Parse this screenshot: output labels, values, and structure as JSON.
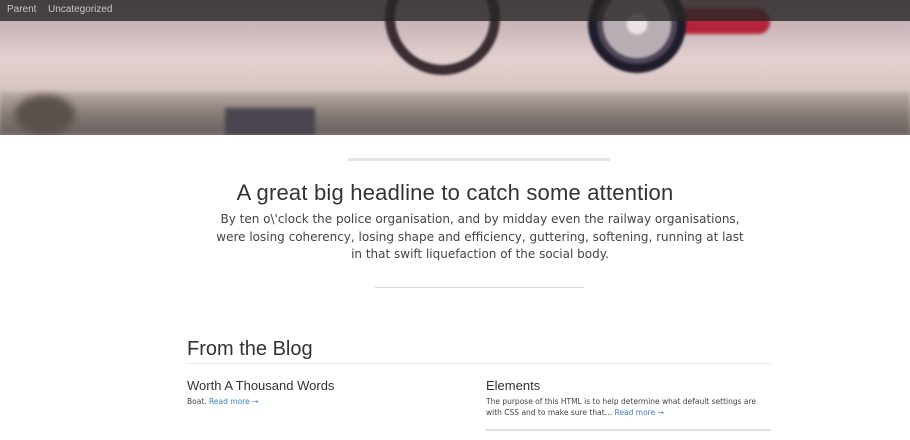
{
  "nav": {
    "items": [
      {
        "label": "Parent"
      },
      {
        "label": "Uncategorized"
      }
    ]
  },
  "hero": {
    "headline": "A great big headline to catch some attention",
    "lead": "By ten o\\'clock the police organisation, and by midday even the railway organisations, were losing coherency, losing shape and efficiency, guttering, softening, running at last in that swift liquefaction of the social body."
  },
  "blog": {
    "title": "From the Blog",
    "read_more_label": "Read more →",
    "posts": [
      {
        "title": "Worth A Thousand Words",
        "excerpt": "Boat."
      },
      {
        "title": "Elements",
        "excerpt": "The purpose of this HTML is to help determine what default settings are with CSS and to make sure that…"
      }
    ]
  },
  "colors": {
    "link": "#3a7fc1",
    "navbar": "#282626"
  }
}
